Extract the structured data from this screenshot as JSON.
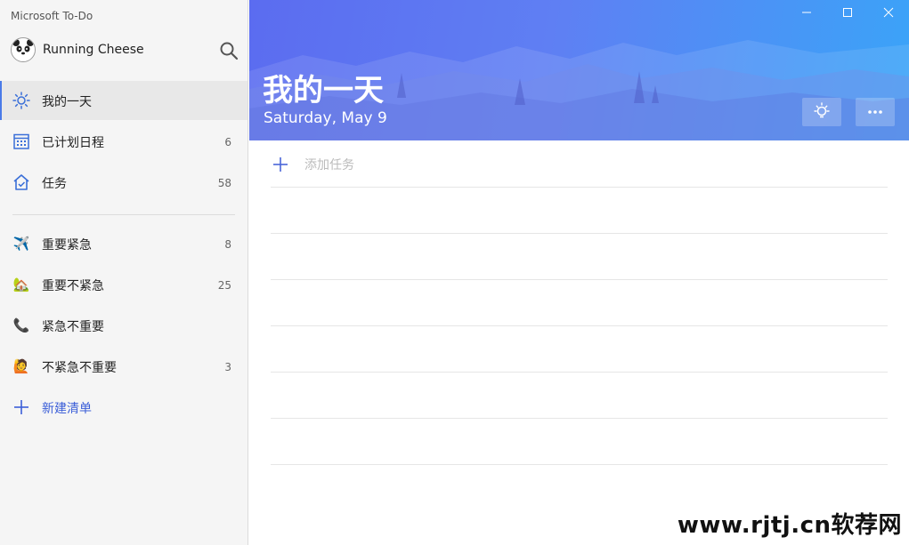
{
  "app": {
    "title": "Microsoft To-Do"
  },
  "profile": {
    "name": "Running Cheese"
  },
  "sidebar": {
    "items": [
      {
        "label": "我的一天",
        "count": "",
        "icon": "sun-icon"
      },
      {
        "label": "已计划日程",
        "count": "6",
        "icon": "calendar-icon"
      },
      {
        "label": "任务",
        "count": "58",
        "icon": "home-icon"
      }
    ],
    "lists": [
      {
        "label": "重要紧急",
        "count": "8",
        "icon": "airplane-emoji-icon",
        "emoji": "✈️"
      },
      {
        "label": "重要不紧急",
        "count": "25",
        "icon": "house-emoji-icon",
        "emoji": "🏡"
      },
      {
        "label": "紧急不重要",
        "count": "",
        "icon": "phone-emoji-icon",
        "emoji": "📞"
      },
      {
        "label": "不紧急不重要",
        "count": "3",
        "icon": "person-emoji-icon",
        "emoji": "🙋"
      }
    ],
    "new_list_label": "新建清单"
  },
  "main": {
    "title": "我的一天",
    "date": "Saturday, May 9",
    "add_task_placeholder": "添加任务"
  },
  "watermark": "www.rjtj.cn软荐网",
  "colors": {
    "accent": "#4a7be8",
    "banner_start": "#5b6cf0",
    "banner_end": "#3aa4f8"
  }
}
